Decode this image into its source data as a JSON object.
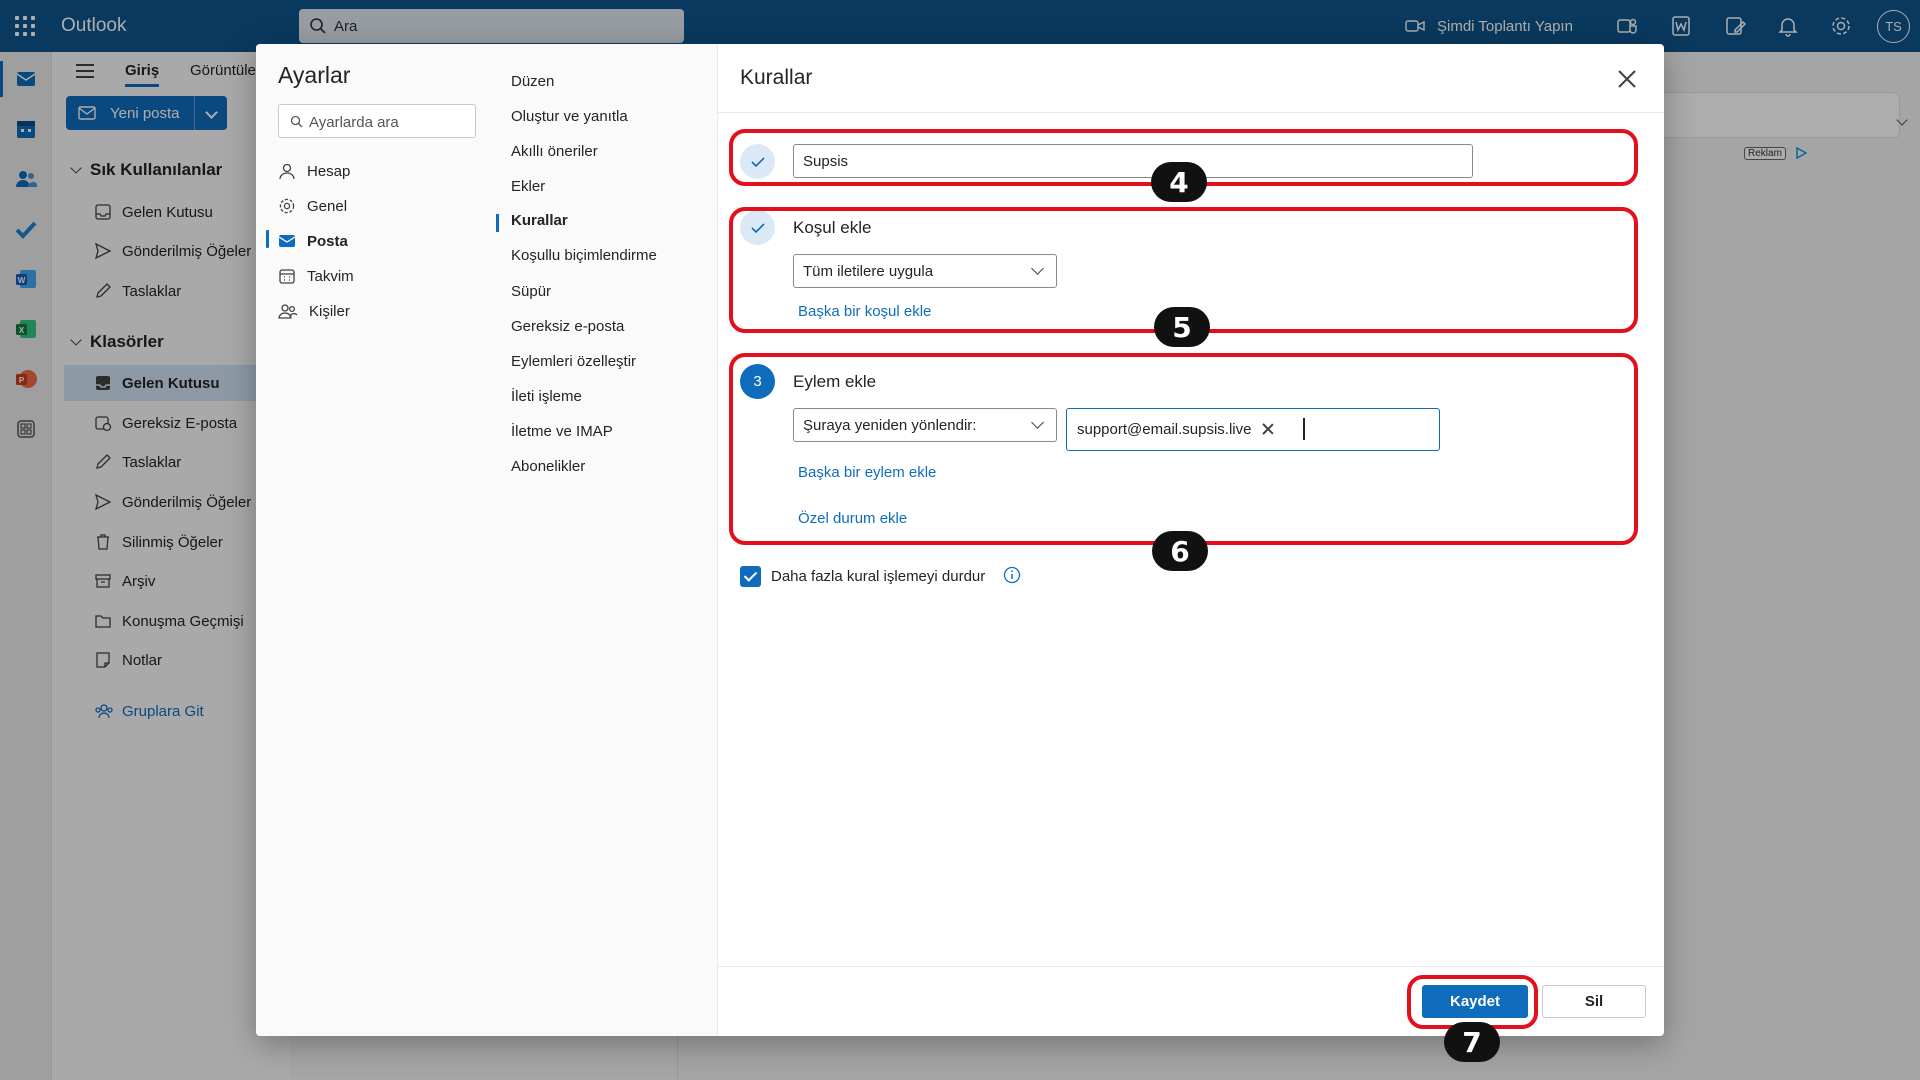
{
  "app": {
    "name": "Outlook",
    "search_placeholder": "Ara"
  },
  "topbar": {
    "meet_now": "Şimdi Toplantı Yapın",
    "avatar_initials": "TS"
  },
  "ribbon": {
    "tab_home": "Giriş",
    "tab_view": "Görüntüle",
    "new_mail": "Yeni posta"
  },
  "folders": {
    "favorites_title": "Sık Kullanılanlar",
    "favorites": [
      "Gelen Kutusu",
      "Gönderilmiş Öğeler",
      "Taslaklar"
    ],
    "folders_title": "Klasörler",
    "items": [
      "Gelen Kutusu",
      "Gereksiz E-posta",
      "Taslaklar",
      "Gönderilmiş Öğeler",
      "Silinmiş Öğeler",
      "Arşiv",
      "Konuşma Geçmişi",
      "Notlar"
    ],
    "groups_link": "Gruplara Git"
  },
  "ad_label": "Reklam",
  "settings": {
    "title": "Ayarlar",
    "search_placeholder": "Ayarlarda ara",
    "categories": [
      "Hesap",
      "Genel",
      "Posta",
      "Takvim",
      "Kişiler"
    ],
    "selected_category": "Posta",
    "subcategories": [
      "Düzen",
      "Oluştur ve yanıtla",
      "Akıllı öneriler",
      "Ekler",
      "Kurallar",
      "Koşullu biçimlendirme",
      "Süpür",
      "Gereksiz e-posta",
      "Eylemleri özelleştir",
      "İleti işleme",
      "İletme ve IMAP",
      "Abonelikler"
    ],
    "selected_subcategory": "Kurallar"
  },
  "rules": {
    "title": "Kurallar",
    "rule_name": "Supsis",
    "condition": {
      "label": "Koşul ekle",
      "selected": "Tüm iletilere uygula",
      "add_link": "Başka bir koşul ekle"
    },
    "action": {
      "step": "3",
      "label": "Eylem ekle",
      "selected": "Şuraya yeniden yönlendir:",
      "recipient": "support@email.supsis.live",
      "add_link": "Başka bir eylem ekle",
      "exception_link": "Özel durum ekle"
    },
    "stop_processing": {
      "label": "Daha fazla kural işlemeyi durdur",
      "checked": true
    },
    "save": "Kaydet",
    "delete": "Sil"
  },
  "annotations": {
    "step4": "4",
    "step5": "5",
    "step6": "6",
    "step7": "7"
  },
  "colors": {
    "brand": "#0f548c",
    "accent": "#0f6cbd",
    "highlight": "#e3101c"
  }
}
